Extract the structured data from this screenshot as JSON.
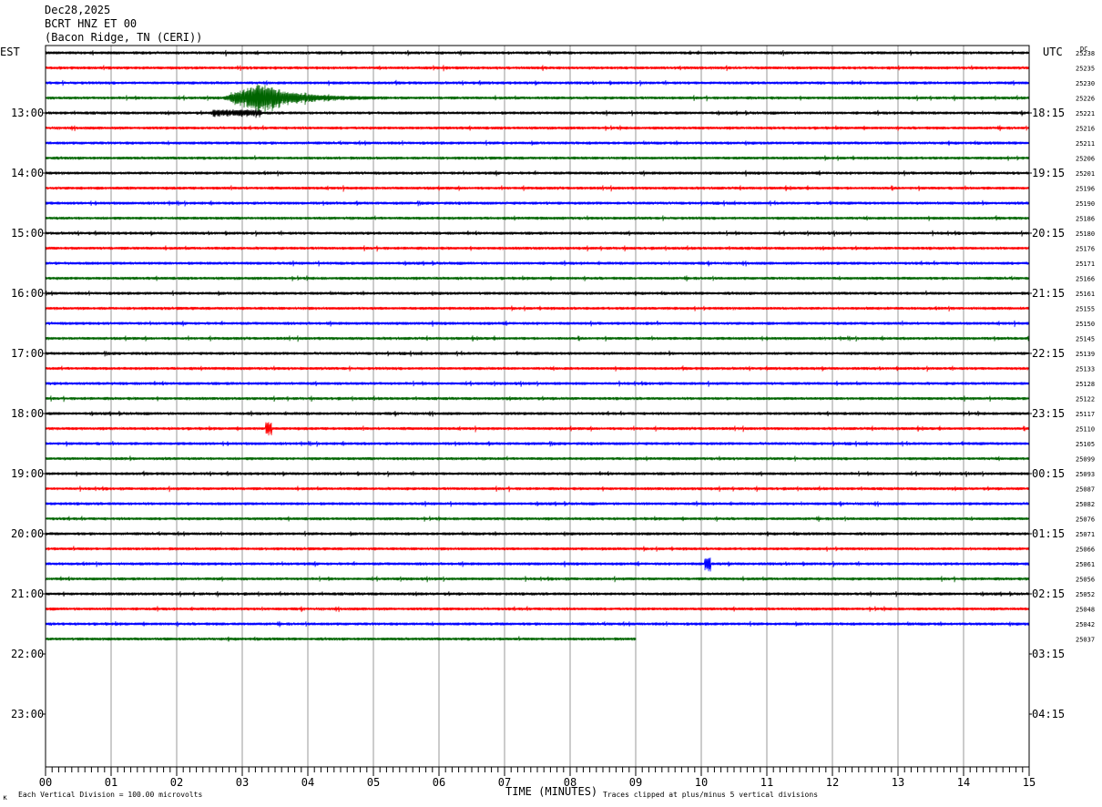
{
  "header": {
    "date": "Dec28,2025",
    "station": "BCRT HNZ ET 00",
    "location": "(Bacon Ridge, TN (CERI))"
  },
  "labels": {
    "left_axis": "EST",
    "right_axis": "UTC",
    "dc": "DC",
    "xlabel": "TIME (MINUTES)",
    "scale_note": "Each Vertical Division =  100.00 microvolts",
    "clip_note": "Traces clipped at plus/minus 5 vertical divisions",
    "corner_mark": "κ"
  },
  "chart_data": {
    "type": "line",
    "title": "BCRT HNZ ET 00",
    "xlabel": "TIME (MINUTES)",
    "xlim": [
      0,
      15
    ],
    "x_ticks": [
      "00",
      "01",
      "02",
      "03",
      "04",
      "05",
      "06",
      "07",
      "08",
      "09",
      "10",
      "11",
      "12",
      "13",
      "14",
      "15"
    ],
    "grid": true,
    "left_hour_labels": [
      "13:00",
      "14:00",
      "15:00",
      "16:00",
      "17:00",
      "18:00",
      "19:00",
      "20:00",
      "21:00",
      "22:00",
      "23:00"
    ],
    "right_hour_labels": [
      "18:15",
      "19:15",
      "20:15",
      "21:15",
      "22:15",
      "23:15",
      "00:15",
      "01:15",
      "02:15",
      "03:15",
      "04:15"
    ],
    "trace_colors": [
      "#000000",
      "#ff0000",
      "#0000ff",
      "#006400"
    ],
    "dc_offsets": [
      "25238",
      "25235",
      "25230",
      "25226",
      "25221",
      "25216",
      "25211",
      "25206",
      "25201",
      "25196",
      "25190",
      "25186",
      "25180",
      "25176",
      "25171",
      "25166",
      "25161",
      "25155",
      "25150",
      "25145",
      "25139",
      "25133",
      "25128",
      "25122",
      "25117",
      "25110",
      "25105",
      "25099",
      "25093",
      "25087",
      "25082",
      "25076",
      "25071",
      "25066",
      "25061",
      "25056",
      "25052",
      "25048",
      "25042",
      "25037"
    ],
    "last_trace_end_minute": 9.0,
    "events": [
      {
        "trace": 3,
        "start_min": 2.7,
        "end_min": 5.2,
        "peak_min": 3.3,
        "amplitude": "large"
      },
      {
        "trace": 4,
        "start_min": 2.55,
        "end_min": 3.3,
        "peak_min": 3.3,
        "amplitude": "small"
      },
      {
        "trace": 25,
        "start_min": 3.35,
        "end_min": 3.45,
        "peak_min": 3.4,
        "amplitude": "spike"
      },
      {
        "trace": 34,
        "start_min": 10.05,
        "end_min": 10.15,
        "peak_min": 10.1,
        "amplitude": "spike"
      }
    ]
  }
}
